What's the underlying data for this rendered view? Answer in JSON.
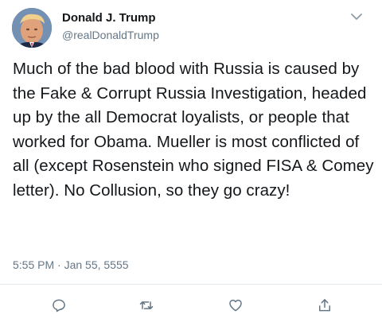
{
  "tweet": {
    "author_name": "Donald J. Trump",
    "author_handle": "@realDonaldTrump",
    "text": "Much of the bad blood with Russia is caused by the Fake & Corrupt Russia Investigation, headed up by the all Democrat loyalists, or people that worked for Obama. Mueller is most conflicted of all (except Rosenstein who signed FISA & Comey letter). No Collusion, so they go crazy!",
    "timestamp": "5:55 PM · Jan 55, 5555"
  },
  "icons": {
    "menu": "chevron-down-icon",
    "reply": "reply-icon",
    "retweet": "retweet-icon",
    "like": "heart-icon",
    "share": "share-icon"
  },
  "colors": {
    "text": "#14171a",
    "secondary": "#657786",
    "divider": "#e1e8ed"
  }
}
